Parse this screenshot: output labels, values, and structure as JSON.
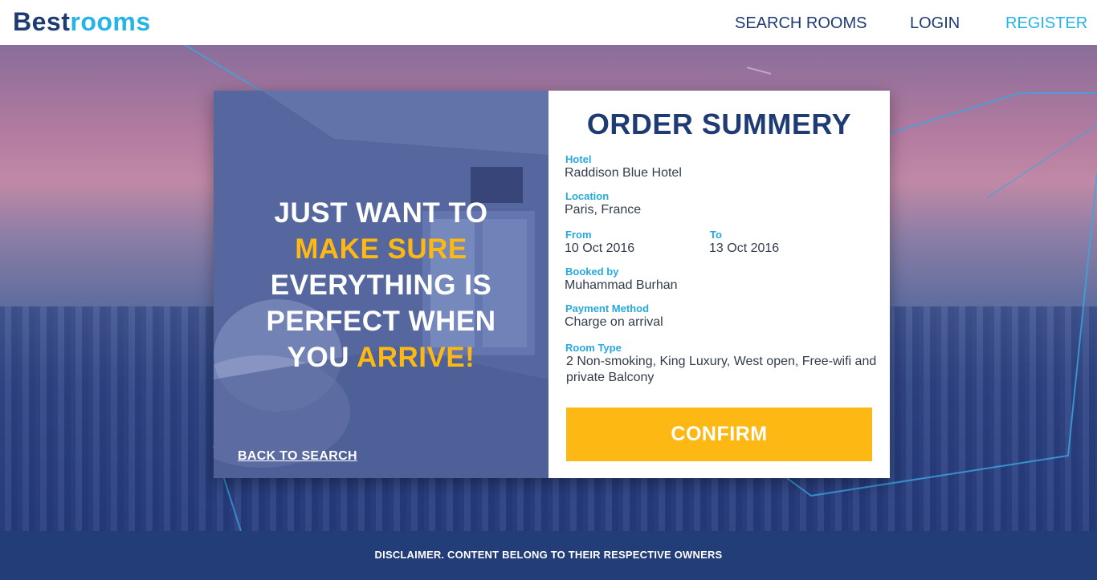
{
  "header": {
    "logo_part1": "Best",
    "logo_part2": "rooms",
    "nav": {
      "search_rooms": "SEARCH ROOMS",
      "login": "LOGIN",
      "register": "REGISTER"
    }
  },
  "promo": {
    "line1": "JUST WANT TO",
    "line2_highlight": "MAKE SURE",
    "line3": "EVERYTHING IS",
    "line4": "PERFECT WHEN",
    "line5_start": "YOU",
    "line5_highlight": "ARRIVE!",
    "back_link": "BACK TO SEARCH"
  },
  "summary": {
    "title": "ORDER SUMMERY",
    "hotel_label": "Hotel",
    "hotel_value": "Raddison Blue Hotel",
    "location_label": "Location",
    "location_value": "Paris, France",
    "from_label": "From",
    "from_value": "10 Oct 2016",
    "to_label": "To",
    "to_value": "13 Oct 2016",
    "booked_by_label": "Booked by",
    "booked_by_value": "Muhammad Burhan",
    "payment_label": "Payment Method",
    "payment_value": "Charge on arrival",
    "room_type_label": "Room Type",
    "room_type_value": "2 Non-smoking, King Luxury, West open, Free-wifi and private  Balcony",
    "confirm_label": "CONFIRM"
  },
  "footer": {
    "disclaimer": "DISCLAIMER. CONTENT BELONG TO THEIR RESPECTIVE OWNERS"
  },
  "colors": {
    "brand_dark": "#1f3b73",
    "brand_light": "#26b3e8",
    "accent": "#fdb813",
    "footer_bg": "#233d78"
  }
}
